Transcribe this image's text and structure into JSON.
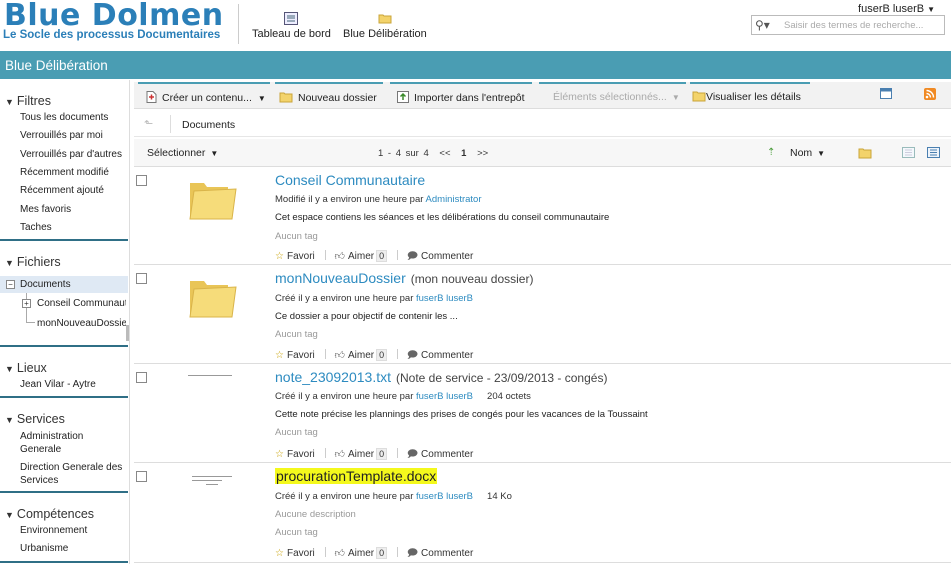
{
  "header": {
    "logo_title": "Blue Dolmen",
    "logo_subtitle": "Le Socle des processus Documentaires",
    "apps": [
      {
        "label": "Tableau de bord"
      },
      {
        "label": "Blue Délibération"
      }
    ],
    "user": "fuserB luserB",
    "search_placeholder": "Saisir des termes de recherche..."
  },
  "site_title": "Blue Délibération",
  "sidebar": {
    "filtres": {
      "title": "Filtres",
      "items": [
        "Tous les documents",
        "Verrouillés par moi",
        "Verrouillés par d'autres",
        "Récemment modifié",
        "Récemment ajouté",
        "Mes favoris",
        "Taches"
      ]
    },
    "fichiers": {
      "title": "Fichiers",
      "root": "Documents",
      "children": [
        "Conseil Communautaire",
        "monNouveauDossier"
      ]
    },
    "lieux": {
      "title": "Lieux",
      "items": [
        "Jean Vilar - Aytre"
      ]
    },
    "services": {
      "title": "Services",
      "items": [
        "Administration Generale",
        "Direction Generale des Services"
      ]
    },
    "competences": {
      "title": "Compétences",
      "items": [
        "Environnement",
        "Urbanisme"
      ]
    }
  },
  "toolbar": {
    "create": "Créer un contenu...",
    "new_folder": "Nouveau dossier",
    "import": "Importer dans l'entrepôt",
    "selected": "Éléments sélectionnés...",
    "details": "Visualiser les détails"
  },
  "breadcrumb": "Documents",
  "listbar": {
    "select": "Sélectionner",
    "range": "1 - 4 sur 4",
    "prev": "<<",
    "page": "1",
    "next": ">>",
    "sort": "Nom"
  },
  "rows": [
    {
      "name": "Conseil Communautaire",
      "aux": "",
      "meta_prefix": "Modifié il y a environ une heure par",
      "author": "Administrator",
      "size": "",
      "desc": "Cet espace contiens les séances et les délibérations du conseil communautaire",
      "tag": "Aucun tag",
      "likes": "0"
    },
    {
      "name": "monNouveauDossier",
      "aux": "(mon nouveau dossier)",
      "meta_prefix": "Créé il y a environ une heure par",
      "author": "fuserB luserB",
      "size": "",
      "desc": "Ce dossier a pour objectif de contenir les ...",
      "tag": "Aucun tag",
      "likes": "0"
    },
    {
      "name": "note_23092013.txt",
      "aux": "(Note de service - 23/09/2013 - congés)",
      "meta_prefix": "Créé il y a environ une heure par",
      "author": "fuserB luserB",
      "size": "204 octets",
      "desc": "Cette note précise les plannings des prises de congés pour les vacances de la Toussaint",
      "tag": "Aucun tag",
      "likes": "0"
    },
    {
      "name": "procurationTemplate.docx",
      "aux": "",
      "meta_prefix": "Créé il y a environ une heure par",
      "author": "fuserB luserB",
      "size": "14 Ko",
      "desc": "Aucune description",
      "tag": "Aucun tag",
      "likes": "0"
    }
  ],
  "actions": {
    "fav": "Favori",
    "like": "Aimer",
    "comment": "Commenter"
  }
}
